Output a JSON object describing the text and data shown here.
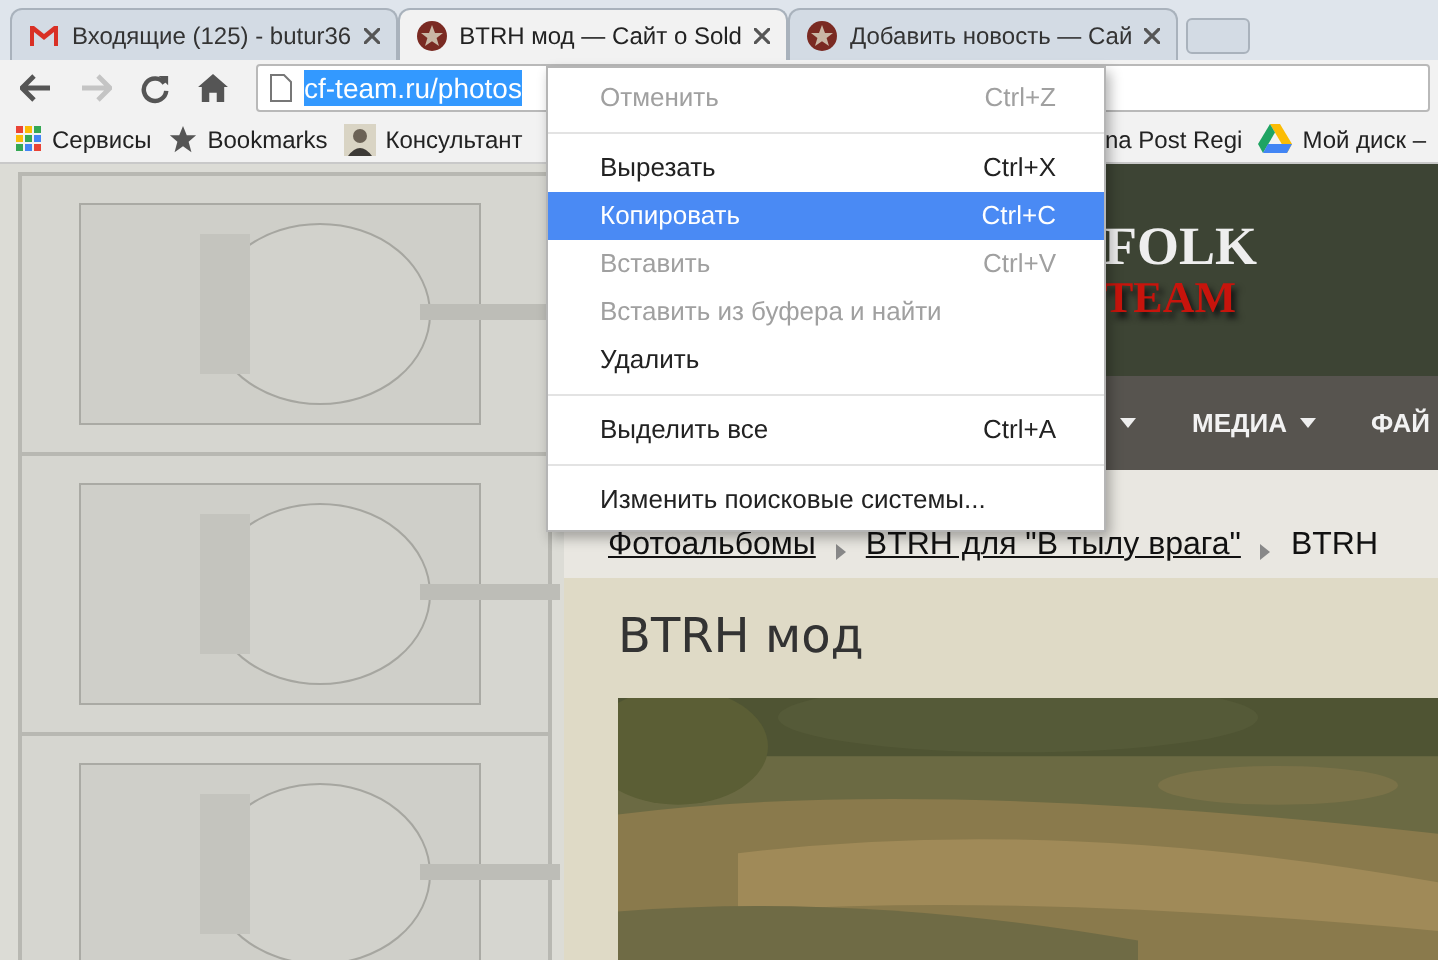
{
  "tabs": [
    {
      "kind": "mail",
      "title": "Входящие (125) - butur36",
      "selected": false
    },
    {
      "kind": "site",
      "title": "BTRH мод — Сайт о Sold",
      "selected": true
    },
    {
      "kind": "site",
      "title": "Добавить новость — Сай",
      "selected": false
    }
  ],
  "toolbar": {
    "forward_disabled": true,
    "url": "cf-team.ru/photos",
    "url_selected": true
  },
  "bookmarks": [
    {
      "kind": "apps",
      "label": "Сервисы"
    },
    {
      "kind": "star",
      "label": "Bookmarks"
    },
    {
      "kind": "avatar",
      "label": "Консультант"
    },
    {
      "kind": "text",
      "label": "na Post Regi"
    },
    {
      "kind": "drive",
      "label": "Мой диск –"
    }
  ],
  "site_header": {
    "title_line_1": "FOLK",
    "title_line_2": "TEAM"
  },
  "nav": [
    {
      "has_caret": true
    },
    {
      "label": "МЕДИА",
      "has_caret": true
    },
    {
      "label": "ФАЙ",
      "has_caret": false
    }
  ],
  "breadcrumbs": [
    {
      "label": "Фотоальбомы",
      "link": true
    },
    {
      "label": "BTRH для \"В тылу врага\"",
      "link": true
    },
    {
      "label": "BTRH",
      "link": false
    }
  ],
  "page_title": "BTRH мод",
  "context_menu": {
    "groups": [
      [
        {
          "label": "Отменить",
          "shortcut": "Ctrl+Z",
          "disabled": true,
          "selected": false
        }
      ],
      [
        {
          "label": "Вырезать",
          "shortcut": "Ctrl+X",
          "disabled": false,
          "selected": false
        },
        {
          "label": "Копировать",
          "shortcut": "Ctrl+C",
          "disabled": false,
          "selected": true
        },
        {
          "label": "Вставить",
          "shortcut": "Ctrl+V",
          "disabled": true,
          "selected": false
        },
        {
          "label": "Вставить из буфера и найти",
          "disabled": true,
          "selected": false
        },
        {
          "label": "Удалить",
          "disabled": false,
          "selected": false
        }
      ],
      [
        {
          "label": "Выделить все",
          "shortcut": "Ctrl+A",
          "disabled": false,
          "selected": false
        }
      ],
      [
        {
          "label": "Изменить поисковые системы...",
          "disabled": false,
          "selected": false
        }
      ]
    ]
  }
}
